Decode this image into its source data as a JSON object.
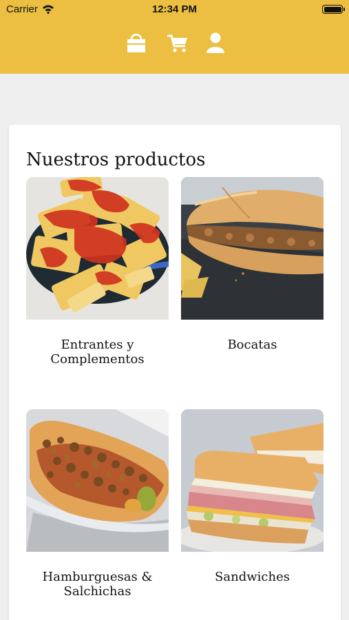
{
  "status_bar": {
    "carrier": "Carrier",
    "time": "12:34 PM"
  },
  "header": {
    "background_color": "#ecbf42",
    "icons": [
      "shopping-bag-icon",
      "cart-icon",
      "user-icon"
    ]
  },
  "main": {
    "title": "Nuestros productos",
    "products": [
      {
        "label": "Entrantes y Complementos",
        "image": "patatas-bravas"
      },
      {
        "label": "Bocatas",
        "image": "bocadillo"
      },
      {
        "label": "Hamburguesas & Salchichas",
        "image": "hot-dog"
      },
      {
        "label": "Sandwiches",
        "image": "sandwich"
      }
    ]
  }
}
